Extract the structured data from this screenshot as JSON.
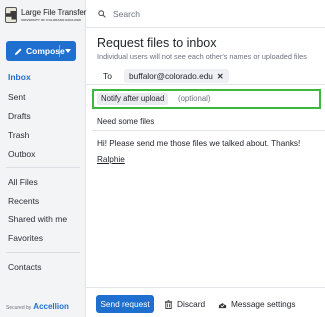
{
  "brand": {
    "title": "Large File Transfer",
    "subtitle": "UNIVERSITY OF COLORADO BOULDER"
  },
  "compose": {
    "label": "Compose"
  },
  "nav": {
    "inbox": "Inbox",
    "sent": "Sent",
    "drafts": "Drafts",
    "trash": "Trash",
    "outbox": "Outbox",
    "all_files": "All Files",
    "recents": "Recents",
    "shared": "Shared with me",
    "favorites": "Favorites",
    "contacts": "Contacts"
  },
  "footer_brand": {
    "secured_by": "Secured by",
    "company": "Accellion"
  },
  "search": {
    "placeholder": "Search"
  },
  "request": {
    "title": "Request files to inbox",
    "subtitle": "Individual users will not see each other's names or uploaded files",
    "to_label": "To",
    "recipient": "buffalor@colorado.edu",
    "notify_label": "Notify after upload",
    "notify_placeholder": "(optional)",
    "subject": "Need some files",
    "body": "Hi! Please send me those files we talked about. Thanks!",
    "signature": "Ralphie"
  },
  "actions": {
    "send": "Send request",
    "discard": "Discard",
    "message_settings": "Message settings"
  },
  "colors": {
    "accent": "#1f6fcf",
    "highlight": "#3cb83c"
  }
}
